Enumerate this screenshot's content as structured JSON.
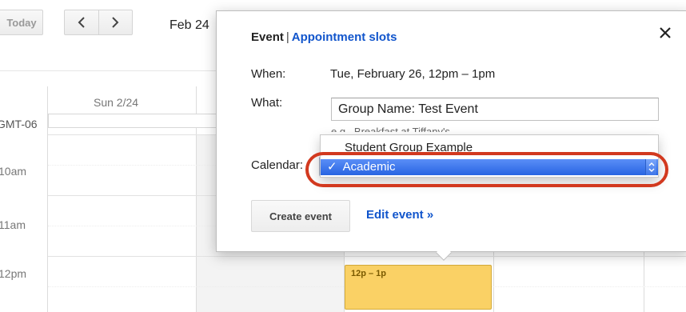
{
  "toolbar": {
    "today_label": "Today",
    "prev_icon": "chevron-left-icon",
    "next_icon": "chevron-right-icon",
    "date_range": "Feb 24"
  },
  "grid": {
    "day_header": "Sun 2/24",
    "timezone_label": "GMT-06",
    "time_labels": [
      "10am",
      "11am",
      "12pm"
    ]
  },
  "event_chip": {
    "label": "12p – 1p",
    "color": "#fad165"
  },
  "bubble": {
    "tab_event": "Event",
    "tab_separator": "|",
    "tab_appointment": "Appointment slots",
    "close_icon": "close-icon",
    "when_label": "When:",
    "when_value": "Tue, February 26, 12pm – 1pm",
    "what_label": "What:",
    "what_value": "Group Name: Test Event",
    "what_hint": "e.g., Breakfast at Tiffany's",
    "calendar_label": "Calendar:",
    "create_label": "Create event",
    "edit_link": "Edit event »"
  },
  "calendar_dropdown": {
    "options": [
      "Student Group Example",
      "Academic"
    ],
    "selected": "Academic",
    "check_mark": "✓",
    "highlight_color": "#d2391f"
  }
}
